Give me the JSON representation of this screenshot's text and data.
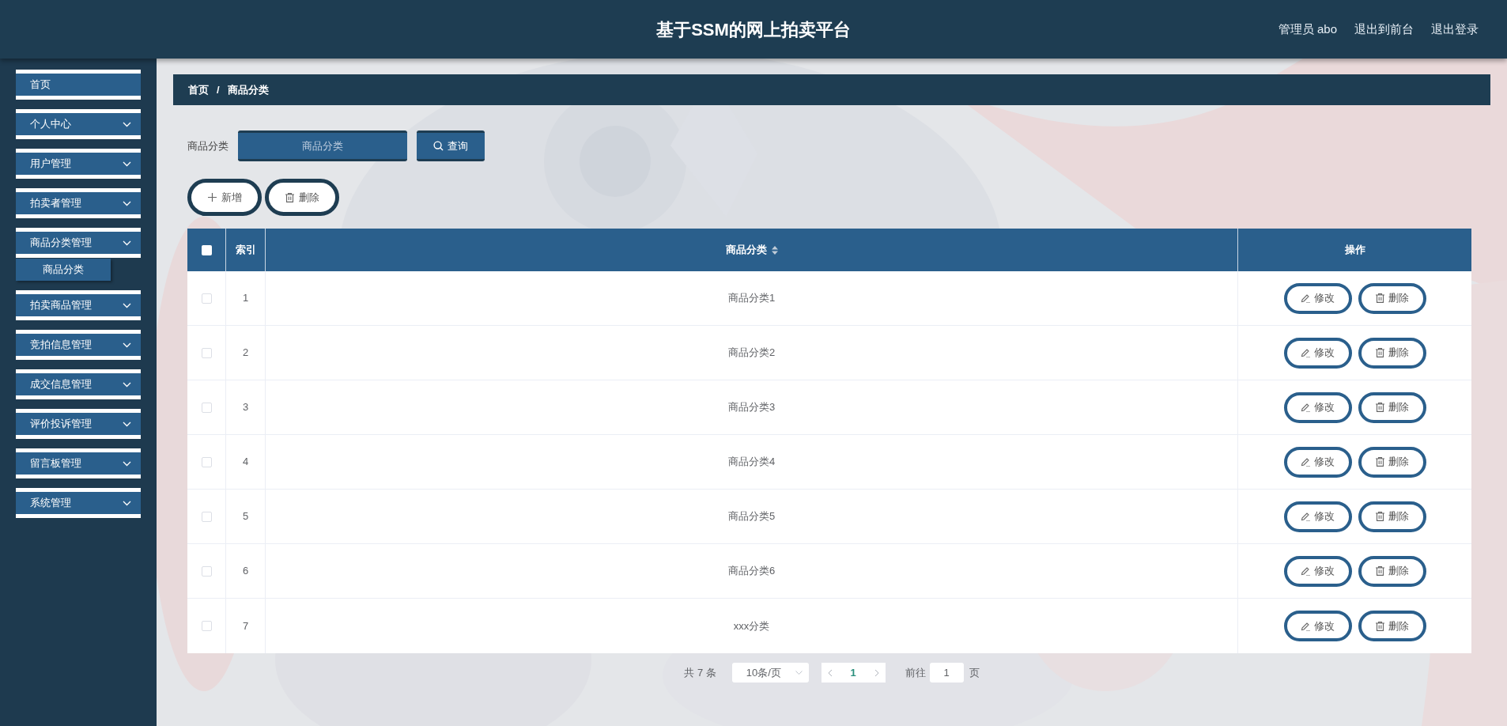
{
  "header": {
    "title": "基于SSM的网上拍卖平台",
    "links": [
      "管理员 abo",
      "退出到前台",
      "退出登录"
    ]
  },
  "sidebar": {
    "items": [
      {
        "label": "首页",
        "kind": "link"
      },
      {
        "label": "个人中心",
        "kind": "menu"
      },
      {
        "label": "用户管理",
        "kind": "menu"
      },
      {
        "label": "拍卖者管理",
        "kind": "menu"
      },
      {
        "label": "商品分类管理",
        "kind": "menu",
        "children": [
          {
            "label": "商品分类",
            "selected": true
          }
        ]
      },
      {
        "label": "拍卖商品管理",
        "kind": "menu"
      },
      {
        "label": "竞拍信息管理",
        "kind": "menu"
      },
      {
        "label": "成交信息管理",
        "kind": "menu"
      },
      {
        "label": "评价投诉管理",
        "kind": "menu"
      },
      {
        "label": "留言板管理",
        "kind": "menu"
      },
      {
        "label": "系统管理",
        "kind": "menu"
      }
    ]
  },
  "breadcrumb": {
    "items": [
      "首页",
      "商品分类"
    ],
    "separator": "/"
  },
  "search": {
    "label": "商品分类",
    "placeholder": "商品分类",
    "button": "查询"
  },
  "actions": [
    {
      "label": "新增",
      "kind": "add"
    },
    {
      "label": "删除",
      "kind": "delete"
    }
  ],
  "table": {
    "select_all_checked": false,
    "columns": {
      "index": "索引",
      "category": "商品分类",
      "actions": "操作"
    },
    "category_sortable": true,
    "rows": [
      {
        "checked": false,
        "index": "1",
        "category": "商品分类1",
        "buttons": [
          {
            "label": "修改",
            "kind": "edit"
          },
          {
            "label": "删除",
            "kind": "delete"
          }
        ]
      },
      {
        "checked": false,
        "index": "2",
        "category": "商品分类2",
        "buttons": [
          {
            "label": "修改",
            "kind": "edit"
          },
          {
            "label": "删除",
            "kind": "delete"
          }
        ]
      },
      {
        "checked": false,
        "index": "3",
        "category": "商品分类3",
        "buttons": [
          {
            "label": "修改",
            "kind": "edit"
          },
          {
            "label": "删除",
            "kind": "delete"
          }
        ]
      },
      {
        "checked": false,
        "index": "4",
        "category": "商品分类4",
        "buttons": [
          {
            "label": "修改",
            "kind": "edit"
          },
          {
            "label": "删除",
            "kind": "delete"
          }
        ]
      },
      {
        "checked": false,
        "index": "5",
        "category": "商品分类5",
        "buttons": [
          {
            "label": "修改",
            "kind": "edit"
          },
          {
            "label": "删除",
            "kind": "delete"
          }
        ]
      },
      {
        "checked": false,
        "index": "6",
        "category": "商品分类6",
        "buttons": [
          {
            "label": "修改",
            "kind": "edit"
          },
          {
            "label": "删除",
            "kind": "delete"
          }
        ]
      },
      {
        "checked": false,
        "index": "7",
        "category": "xxx分类",
        "buttons": [
          {
            "label": "修改",
            "kind": "edit"
          },
          {
            "label": "删除",
            "kind": "delete"
          }
        ]
      }
    ]
  },
  "pagination": {
    "total": "共 7 条",
    "page_size": "10条/页",
    "current_page": "1",
    "goto_label": "前往",
    "goto_value": "1",
    "page_suffix": "页"
  }
}
